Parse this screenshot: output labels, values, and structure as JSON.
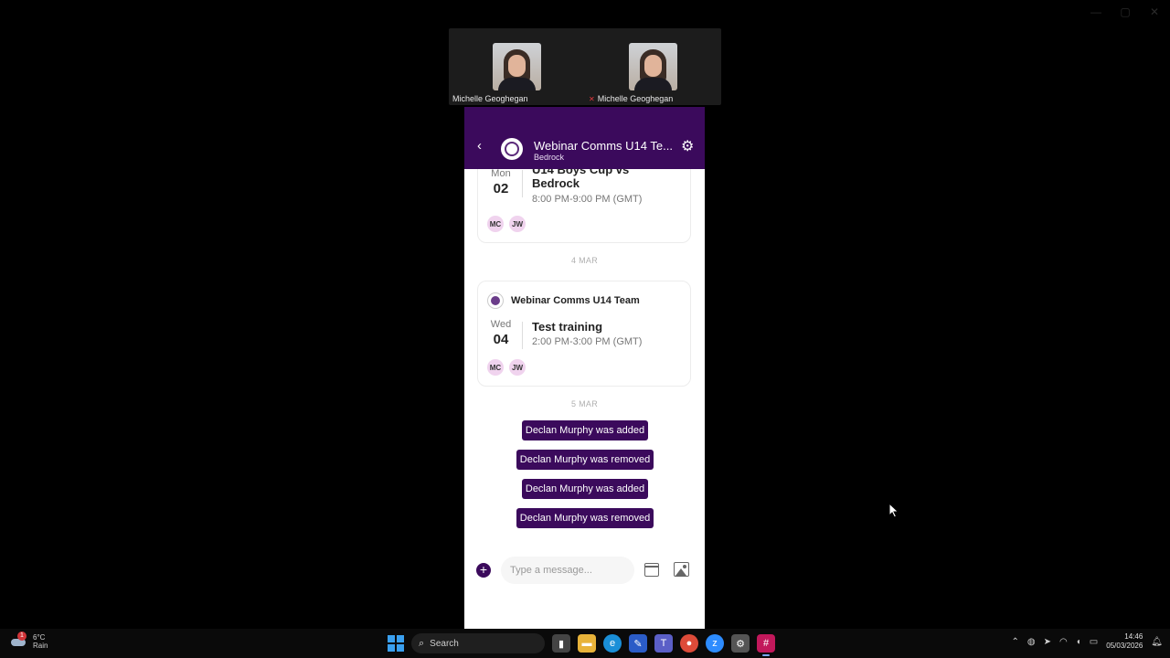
{
  "window_controls": {
    "minimize": "—",
    "maximize": "▢",
    "close": "✕"
  },
  "participants": [
    {
      "name": "Michelle Geoghegan",
      "muted": false
    },
    {
      "name": "Michelle Geoghegan",
      "muted": true
    }
  ],
  "app": {
    "header": {
      "back_icon": "‹",
      "title": "Webinar Comms U14 Te...",
      "subtitle": "Bedrock",
      "settings_icon": "⚙"
    },
    "events": [
      {
        "day_of_week": "Mon",
        "day": "02",
        "title": "U14 Boys Cup vs Bedrock",
        "time": "8:00 PM-9:00 PM (GMT)",
        "attendees": [
          "MC",
          "JW"
        ]
      },
      {
        "team": "Webinar Comms U14 Team",
        "day_of_week": "Wed",
        "day": "04",
        "title": "Test training",
        "time": "2:00 PM-3:00 PM (GMT)",
        "attendees": [
          "MC",
          "JW"
        ]
      }
    ],
    "date_separators": [
      "4 MAR",
      "5 MAR"
    ],
    "system_messages": [
      "Declan Murphy was added",
      "Declan Murphy was removed",
      "Declan Murphy was added",
      "Declan Murphy was removed"
    ],
    "composer": {
      "placeholder": "Type a message..."
    }
  },
  "taskbar": {
    "weather": {
      "temp": "6°C",
      "condition": "Rain",
      "badge": "1"
    },
    "search_label": "Search",
    "clock": {
      "time": "14:46",
      "date": "05/03/2026"
    }
  },
  "colors": {
    "brand": "#3b0a5c",
    "chip": "#f0d3ee"
  }
}
